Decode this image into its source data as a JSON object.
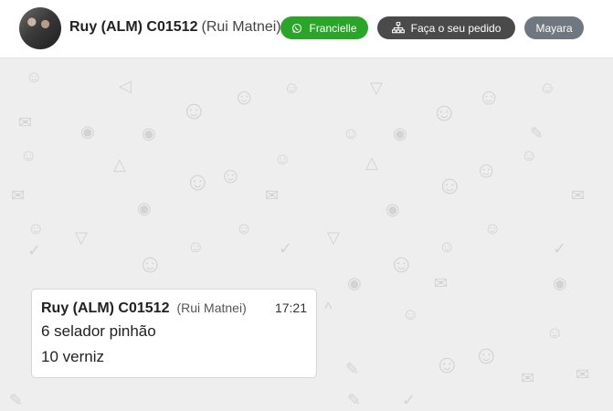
{
  "header": {
    "contact_name": "Ruy (ALM) C01512",
    "contact_sub": "(Rui Matnei)",
    "whatsapp_button": "Francielle",
    "order_button": "Faça o seu pedido",
    "user_badge": "Mayara"
  },
  "message": {
    "sender": "Ruy (ALM) C01512",
    "sender_sub": "(Rui Matnei)",
    "time": "17:21",
    "lines": [
      "6 selador pinhão",
      "10 verniz"
    ]
  },
  "colors": {
    "whatsapp_green": "#2aa52a",
    "order_button": "#4a4a4a",
    "user_badge": "#6f7780",
    "chat_background": "#eeeeee"
  }
}
